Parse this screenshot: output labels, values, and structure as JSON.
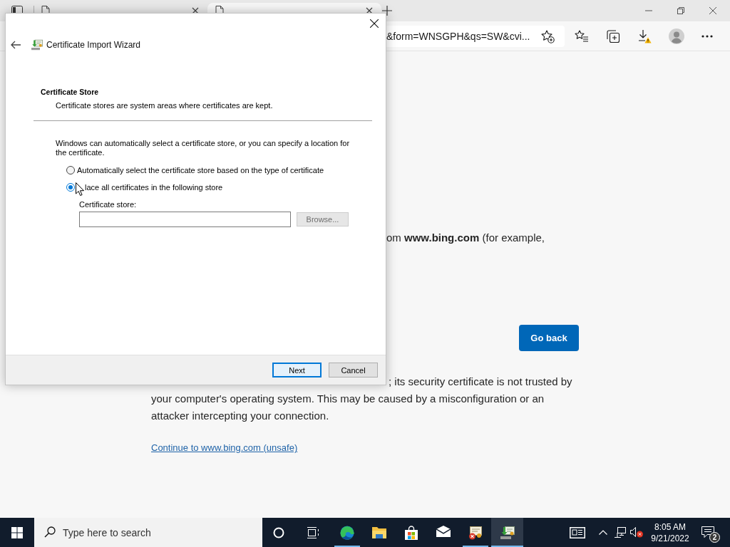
{
  "browser": {
    "tabs": [
      {
        "selected": false
      },
      {
        "selected": true
      }
    ],
    "address_bar": {
      "value": "&form=WNSGPH&qs=SW&cvi..."
    },
    "page": {
      "partial_line": "om **www.bing.com** (for example,",
      "go_back": "Go back",
      "description_lines": [
        "; its security certificate is not trusted by",
        "your computer's operating system. This may be caused by a misconfiguration or an",
        "attacker intercepting your connection."
      ],
      "link": "Continue to www.bing.com (unsafe)"
    }
  },
  "dialog": {
    "title": "Certificate Import Wizard",
    "heading": "Certificate Store",
    "subheading": "Certificate stores are system areas where certificates are kept.",
    "intro": "Windows can automatically select a certificate store, or you can specify a location for the certificate.",
    "options": [
      {
        "label": "Automatically select the certificate store based on the type of certificate",
        "selected": false
      },
      {
        "label": "lace all certificates in the following store",
        "selected": true
      }
    ],
    "store_field": {
      "label": "Certificate store:"
    },
    "browse": {
      "label": "Browse...",
      "disabled": true
    },
    "buttons": [
      {
        "label": "Next",
        "default": true
      },
      {
        "label": "Cancel",
        "default": false
      }
    ]
  },
  "taskbar": {
    "search_placeholder": "Type here to search",
    "apps": [
      {
        "kind": "edge",
        "running": true,
        "selected": false
      },
      {
        "kind": "explorer",
        "running": false,
        "selected": false
      },
      {
        "kind": "store",
        "running": false,
        "selected": false
      },
      {
        "kind": "mail",
        "running": false,
        "selected": false
      },
      {
        "kind": "cert",
        "running": true,
        "selected": false
      },
      {
        "kind": "wizard",
        "running": true,
        "selected": true
      }
    ],
    "tray": {
      "volume_muted": true,
      "time": "8:05 AM",
      "date": "9/21/2022",
      "notification_count": "2"
    }
  }
}
